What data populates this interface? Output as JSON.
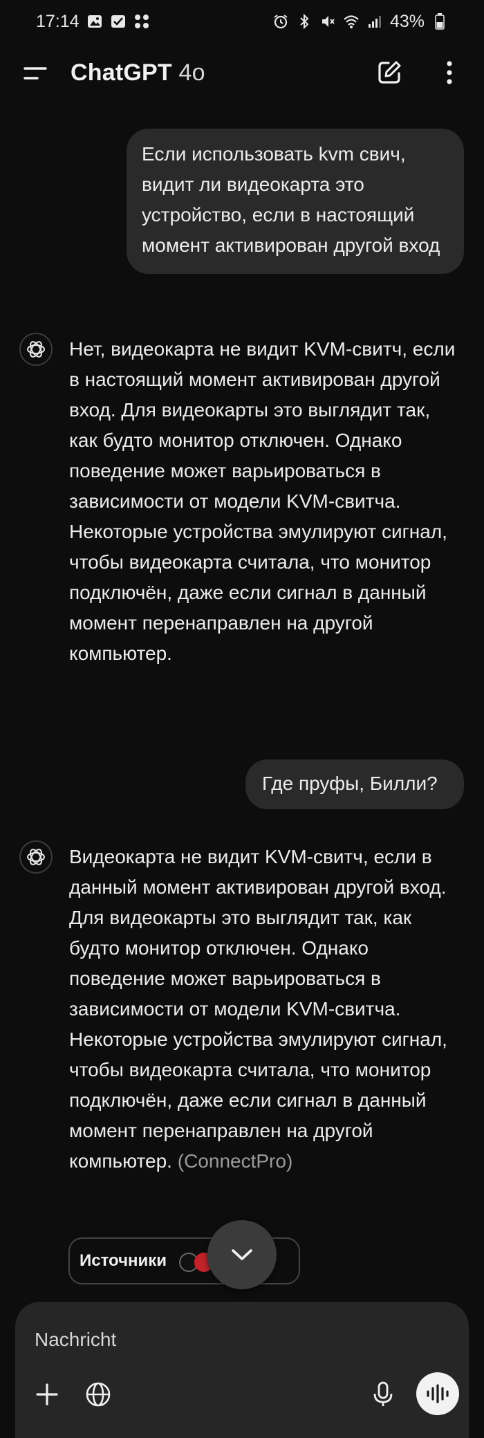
{
  "status_bar": {
    "time": "17:14",
    "battery": "43%"
  },
  "header": {
    "title": "ChatGPT",
    "model": "4o"
  },
  "messages": {
    "user_1": "Если использовать kvm свич, видит ли видеокарта это устройство, если в настоящий момент активирован другой вход",
    "assistant_1": "Нет, видеокарта не видит KVM-свитч, если в настоящий момент активирован другой вход. Для видеокарты это выглядит так, как будто монитор отключен. Однако поведение может варьироваться в зависимости от модели KVM-свитча. Некоторые устройства эмулируют сигнал, чтобы видеокарта считала, что монитор подключён, даже если сигнал в данный момент перенаправлен на другой компьютер.",
    "user_2": "Где пруфы, Билли?",
    "assistant_2": "Видеокарта не видит KVM-свитч, если в данный момент активирован другой вход. Для видеокарты это выглядит так, как будто монитор отключен. Однако поведение может варьироваться в зависимости от модели KVM-свитча. Некоторые устройства эмулируют сигнал, чтобы видеокарта считала, что монитор подключён, даже если сигнал в данный момент перенаправлен на другой компьютер.",
    "assistant_2_source": "ConnectPro",
    "sources_label": "Источники"
  },
  "composer": {
    "placeholder": "Nachricht"
  },
  "icons": {
    "menu": "menu-icon",
    "edit": "new-chat-icon",
    "more": "more-vertical-icon",
    "avatar": "openai-logo-icon",
    "scroll": "chevron-down-icon",
    "plus": "plus-icon",
    "globe": "globe-icon",
    "mic": "microphone-icon",
    "voice": "voice-mode-icon"
  },
  "colors": {
    "background": "#0d0d0d",
    "bubble": "#2a2a2a",
    "composer": "#262626",
    "text": "#ececec",
    "muted": "#9a9a9a"
  }
}
